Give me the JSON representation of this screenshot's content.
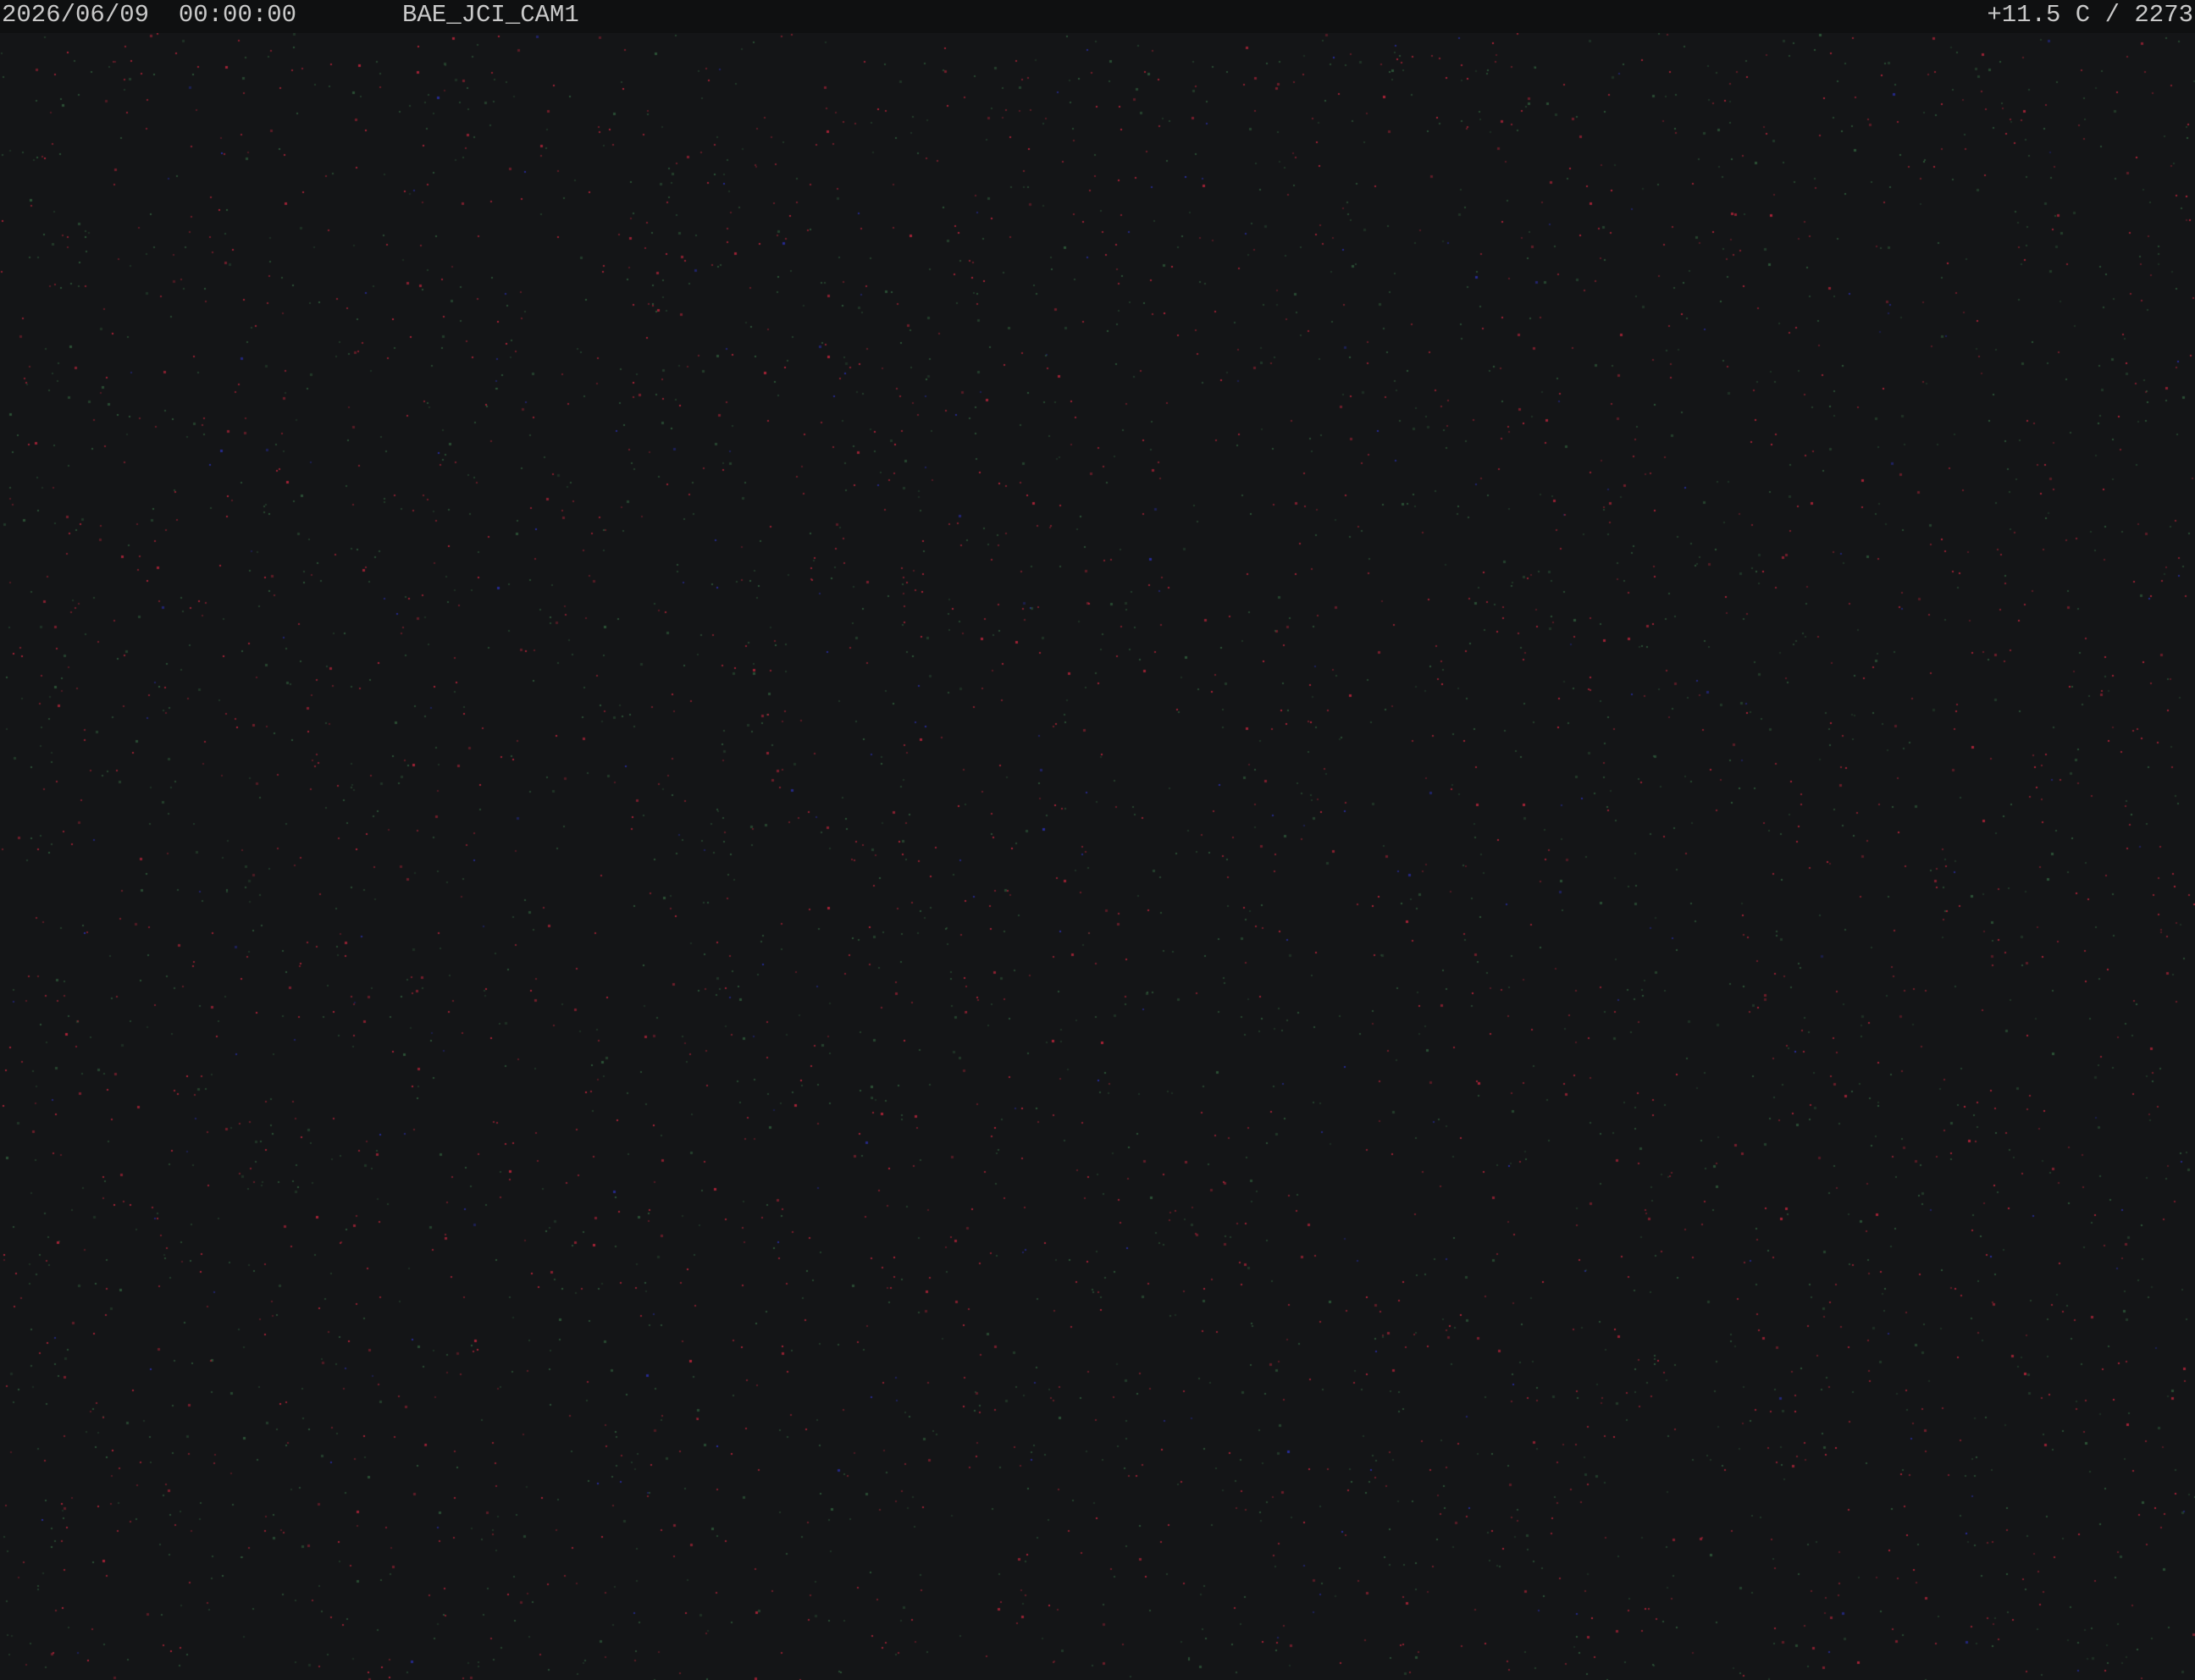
{
  "osd": {
    "datetime": "2026/06/09  00:00:00",
    "camera_id": "BAE_JCI_CAM1",
    "reading": "+11.5 C / 2273"
  },
  "colors": {
    "background": "#141517",
    "overlay_bar": "#0f1011",
    "osd_text": "#c9c9c9",
    "noise_red": "#b8243a",
    "noise_green": "#2f5a3a",
    "noise_blue": "#2a2fa8"
  }
}
